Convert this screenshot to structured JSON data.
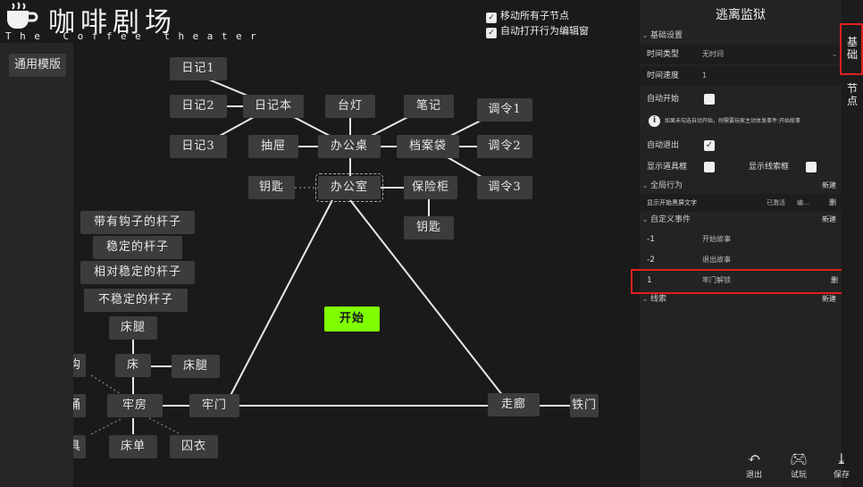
{
  "app": {
    "logo_title": "咖啡剧场",
    "logo_subtitle": "The Coffee theater",
    "template_button": "通用模版"
  },
  "canvas": {
    "options": [
      {
        "label": "移动所有子节点",
        "checked": true
      },
      {
        "label": "自动打开行为编辑窗",
        "checked": true
      }
    ],
    "nodes": {
      "diary1": "日记1",
      "diary2": "日记2",
      "diary3": "日记3",
      "diary_book": "日记本",
      "lamp": "台灯",
      "notebook": "笔记",
      "drawer": "抽屉",
      "desk": "办公桌",
      "archive_bag": "档案袋",
      "order1": "调令1",
      "order2": "调令2",
      "order3": "调令3",
      "key1": "钥匙",
      "office": "办公室",
      "safe": "保险柜",
      "key2": "钥匙",
      "rod_hook": "带有钩子的杆子",
      "rod_stable": "稳定的杆子",
      "rod_rel_stable": "相对稳定的杆子",
      "rod_unstable": "不稳定的杆子",
      "bed_leg1": "床腿",
      "hook": "钩",
      "bed": "床",
      "bed_leg2": "床腿",
      "bucket": "桶",
      "cell": "牢房",
      "cell_door": "牢门",
      "corridor": "走廊",
      "iron": "铁门",
      "tool": "具",
      "sheet": "床单",
      "prison_clothes": "囚衣",
      "start": "开始"
    }
  },
  "panel": {
    "title": "逃离监狱",
    "basic_settings": "基础设置",
    "time_type_label": "时间类型",
    "time_type_value": "无时间",
    "time_speed_label": "时间速度",
    "time_speed_value": "1",
    "auto_start_label": "自动开始",
    "auto_start_checked": false,
    "info_text": "如果未勾选自动开始，则需要玩家主动体发事件:开始故事",
    "auto_exit_label": "自动退出",
    "auto_exit_checked": true,
    "show_item_frame": "显示道具框",
    "show_clue_frame": "显示线索框",
    "global_behavior": "全局行为",
    "new_label": "新建",
    "global_row_label": "显示开始黑屏文字",
    "global_row_status": "已激活",
    "global_row_edit": "编...",
    "delete_label": "删",
    "custom_events": "自定义事件",
    "events": [
      {
        "id": "-1",
        "name": "开始故事"
      },
      {
        "id": "-2",
        "name": "退出故事"
      },
      {
        "id": "1",
        "name": "牢门解锁"
      }
    ],
    "clues": "线索"
  },
  "tabs": {
    "basic": "基础",
    "nodes": "节点"
  },
  "bottom": {
    "exit": "退出",
    "try": "试玩",
    "save": "保存"
  },
  "colors": {
    "accent_green": "#7fff00",
    "highlight_red": "#e02020"
  }
}
